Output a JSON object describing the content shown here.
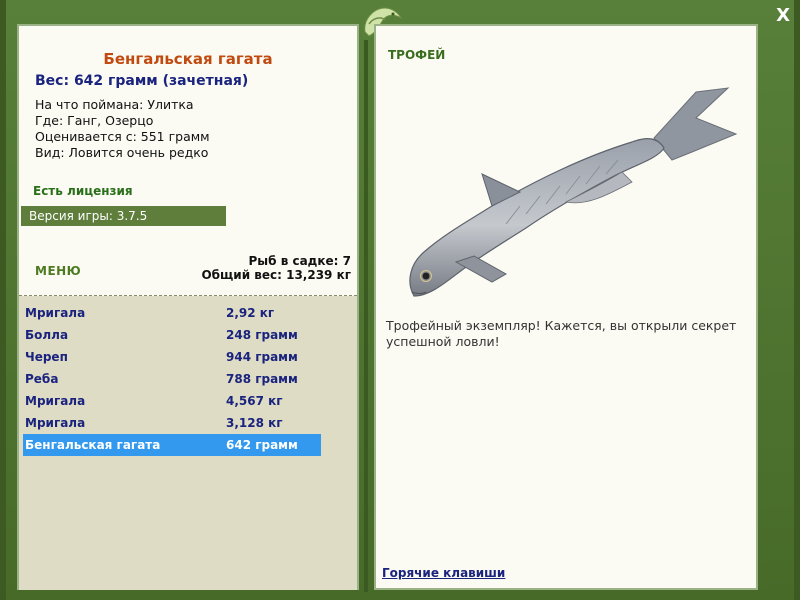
{
  "window": {
    "close_label": "X"
  },
  "fish": {
    "title": "Бенгальская гагата",
    "weight_line": "Вес: 642 грамм (зачетная)",
    "caught_on": "На что поймана: Улитка",
    "where": "Где: Ганг, Озерцо",
    "rated_from": "Оценивается с: 551 грамм",
    "rarity": "Вид: Ловится очень редко"
  },
  "license": "Есть лицензия",
  "version": "Версия игры: 3.7.5",
  "menu_label": "МЕНЮ",
  "keepnet": {
    "count_line": "Рыб в садке: 7",
    "total_line": "Общий вес: 13,239 кг"
  },
  "catches": [
    {
      "name": "Мригала",
      "weight": "2,92 кг"
    },
    {
      "name": "Болла",
      "weight": "248 грамм"
    },
    {
      "name": "Череп",
      "weight": "944 грамм"
    },
    {
      "name": "Реба",
      "weight": "788 грамм"
    },
    {
      "name": "Мригала",
      "weight": "4,567 кг"
    },
    {
      "name": "Мригала",
      "weight": "3,128 кг"
    },
    {
      "name": "Бенгальская гагата",
      "weight": "642 грамм"
    }
  ],
  "trophy": {
    "label": "ТРОФЕЙ",
    "message": "Трофейный экземпляр! Кажется, вы открыли секрет успешной ловли!"
  },
  "hotkeys_label": "Горячие клавиши",
  "colors": {
    "frame_green": "#4b6f2c",
    "title_orange": "#c04a10",
    "link_blue": "#1a237e",
    "selection_blue": "#3399ee"
  }
}
